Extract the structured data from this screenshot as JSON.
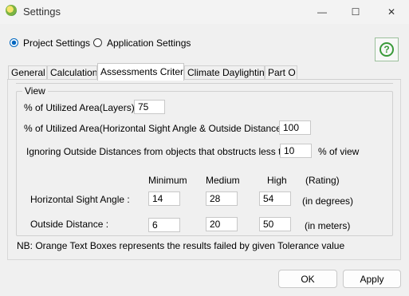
{
  "window": {
    "title": "Settings",
    "minimize_glyph": "—",
    "maximize_glyph": "☐",
    "close_glyph": "✕"
  },
  "mode": {
    "project_label": "Project Settings",
    "application_label": "Application Settings",
    "selected": "project"
  },
  "help": {
    "glyph": "?"
  },
  "tabs": [
    {
      "label": "General"
    },
    {
      "label": "Calculation"
    },
    {
      "label": "Assessments Criteria",
      "active": true
    },
    {
      "label": "Climate Daylighting"
    },
    {
      "label": "Part O"
    }
  ],
  "view": {
    "group_label": "View",
    "utilized_layers_label": "% of Utilized Area(Layers) :",
    "utilized_layers_value": "75",
    "utilized_sight_label": "% of Utilized Area(Horizontal Sight Angle & Outside Distance) :",
    "utilized_sight_value": "100",
    "ignoring_label": "Ignoring Outside Distances from objects that obstructs less than",
    "ignoring_value": "10",
    "ignoring_unit": "% of view",
    "columns": {
      "minimum": "Minimum",
      "medium": "Medium",
      "high": "High",
      "rating": "(Rating)"
    },
    "rows": [
      {
        "label": "Horizontal Sight Angle :",
        "minimum": "14",
        "medium": "28",
        "high": "54",
        "unit": "(in degrees)"
      },
      {
        "label": "Outside Distance :",
        "minimum": "6",
        "medium": "20",
        "high": "50",
        "unit": "(in meters)"
      }
    ]
  },
  "note": "NB: Orange Text Boxes represents the results failed by given Tolerance value",
  "buttons": {
    "ok": "OK",
    "apply": "Apply"
  }
}
